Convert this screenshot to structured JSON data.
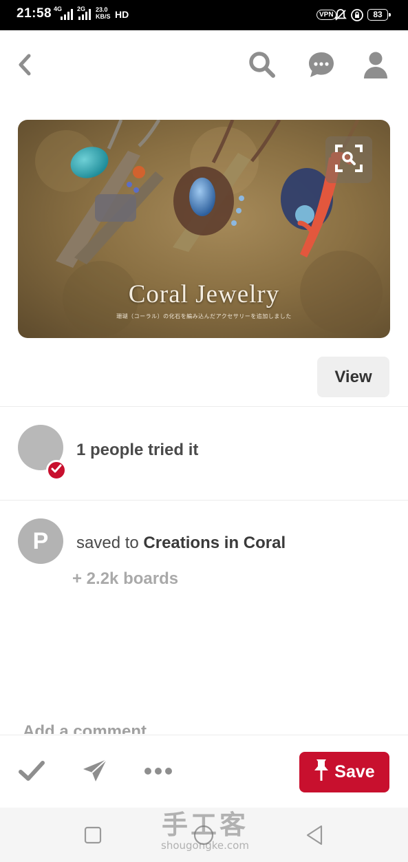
{
  "status_bar": {
    "time": "21:58",
    "network_4g": "4G",
    "network_2g": "2G",
    "speed_value": "23.0",
    "speed_unit": "KB/S",
    "hd_label": "HD",
    "vpn_label": "VPN",
    "battery": "83"
  },
  "top_nav": {
    "back_icon": "chevron-left-icon",
    "search_icon": "search-icon",
    "messages_icon": "chat-bubble-icon",
    "profile_icon": "person-icon"
  },
  "pin": {
    "image_title": "Coral Jewelry",
    "image_subtitle": "珊瑚（コーラル）の化石を編み込んだアクセサリーを追加しました",
    "lens_icon": "visual-search-icon",
    "view_label": "View"
  },
  "tried": {
    "text": "1 people tried it"
  },
  "saved": {
    "avatar_letter": "P",
    "prefix": "saved to ",
    "board_name": "Creations in Coral",
    "boards_more": "+ 2.2k boards"
  },
  "comment": {
    "placeholder": "Add a comment"
  },
  "actions": {
    "tried_icon": "checkmark-icon",
    "send_icon": "paper-plane-icon",
    "more_icon": "ellipsis-icon",
    "save_label": "Save",
    "save_icon": "pushpin-icon"
  },
  "system_nav": {
    "recents_icon": "square-icon",
    "home_icon": "circle-icon",
    "back_icon": "triangle-back-icon"
  },
  "watermark": {
    "cn": "手工客",
    "url": "shougongke.com"
  },
  "colors": {
    "brand_red": "#c8102e",
    "icon_grey": "#8e8e8e",
    "text_dark": "#4a4a4a"
  }
}
